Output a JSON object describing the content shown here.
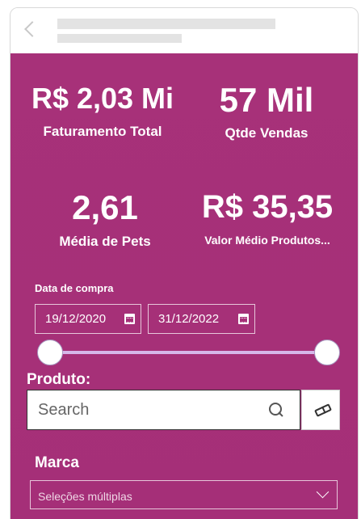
{
  "kpis": {
    "faturamento": {
      "value": "R$ 2,03 Mi",
      "label": "Faturamento Total"
    },
    "vendas": {
      "value": "57 Mil",
      "label": "Qtde Vendas"
    },
    "pets": {
      "value": "2,61",
      "label": "Média de Pets"
    },
    "valor_medio": {
      "value": "R$ 35,35",
      "label": "Valor Médio Produtos..."
    }
  },
  "date_filter": {
    "title": "Data de compra",
    "start": "19/12/2020",
    "end": "31/12/2022",
    "range_position": {
      "start": 0,
      "end": 1
    }
  },
  "produto": {
    "title": "Produto:",
    "search_placeholder": "Search"
  },
  "marca": {
    "title": "Marca",
    "selected": "Seleções múltiplas"
  },
  "icons": {
    "back": "chevron-left-icon",
    "calendar": "calendar-icon",
    "search": "search-icon",
    "eraser": "eraser-icon",
    "dropdown": "chevron-down-icon"
  },
  "colors": {
    "report_background": "#a63079",
    "slider_track": "#d6b7e9",
    "text": "#ffffff"
  }
}
